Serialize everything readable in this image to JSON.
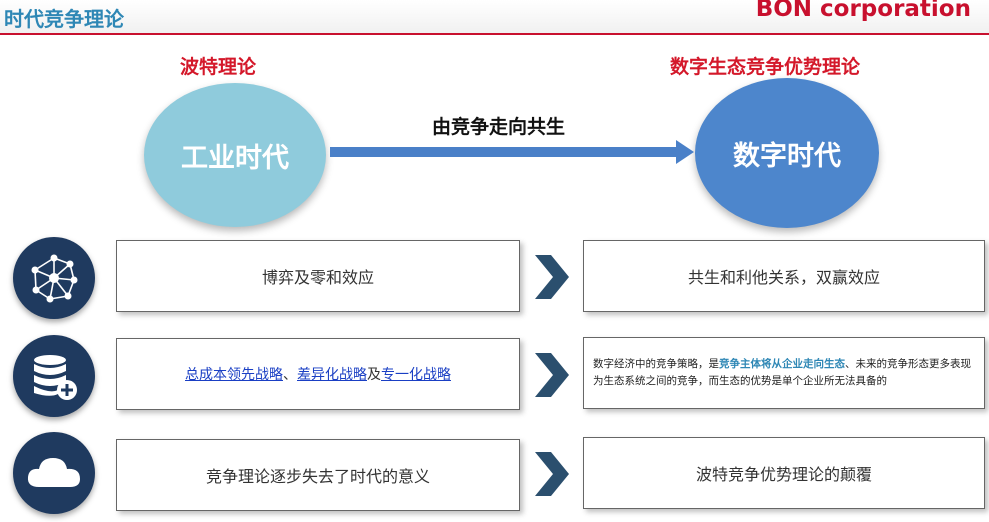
{
  "header": {
    "title": "时代竞争理论",
    "brand": "BON corporation"
  },
  "top": {
    "left_theory": "波特理论",
    "right_theory": "数字生态竞争优势理论",
    "left_era": "工业时代",
    "right_era": "数字时代",
    "transition": "由竞争走向共生"
  },
  "rows": [
    {
      "icon": "network-nodes-icon",
      "left_text": "博弈及零和效应",
      "right_text": "共生和利他关系，双赢效应"
    },
    {
      "icon": "database-add-icon",
      "left_parts": {
        "link1": "总成本领先战略",
        "sep1": "、",
        "link2": "差异化战略",
        "sep2": "及",
        "link3": "专一化战略"
      },
      "right_parts": {
        "pre": "数字经济中的竞争策略，是",
        "highlight": "竞争主体将从企业走向生态",
        "post": "、未来的竞争形态更多表现为生态系统之间的竞争，而生态的优势是单个企业所无法具备的"
      }
    },
    {
      "icon": "cloud-icon",
      "left_text": "竞争理论逐步失去了时代的意义",
      "right_text": "波特竞争优势理论的颠覆"
    }
  ],
  "colors": {
    "title": "#2e87b5",
    "brand": "#c8102e",
    "theory_label": "#d4182a",
    "left_circle": "#8fcbdc",
    "right_circle": "#4d86cc",
    "arrow": "#4a80c8",
    "chevron": "#2b4f6e",
    "icon_bg": "#1f3a5f"
  }
}
